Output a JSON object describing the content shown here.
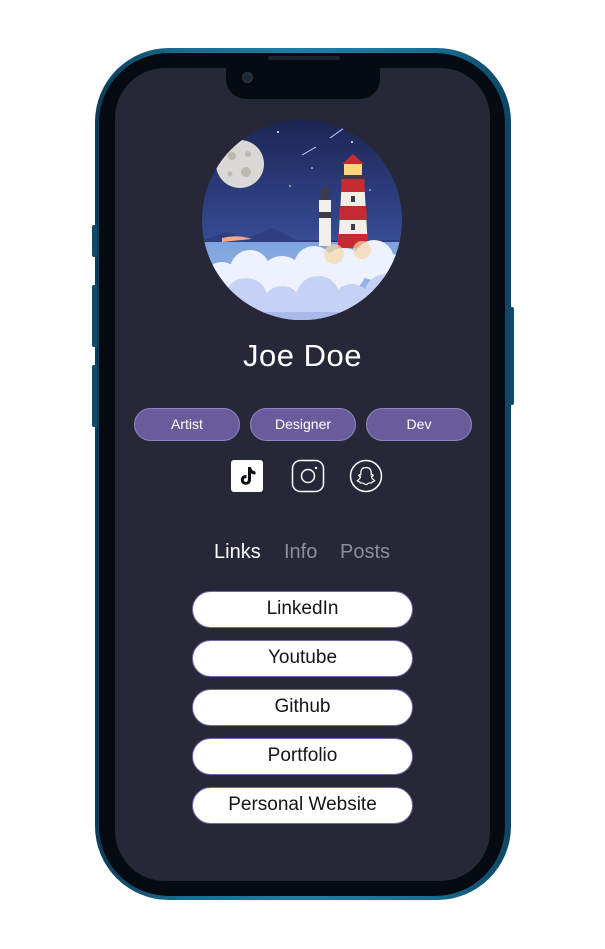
{
  "profile": {
    "name": "Joe Doe",
    "tags": [
      "Artist",
      "Designer",
      "Dev"
    ]
  },
  "social": {
    "icons": [
      "tiktok-icon",
      "instagram-icon",
      "snapchat-icon"
    ]
  },
  "tabs": [
    {
      "label": "Links",
      "active": true
    },
    {
      "label": "Info",
      "active": false
    },
    {
      "label": "Posts",
      "active": false
    }
  ],
  "links": [
    "LinkedIn",
    "Youtube",
    "Github",
    "Portfolio",
    "Personal Website"
  ],
  "colors": {
    "screen_bg": "#262838",
    "tag_bg": "#6a5b9d",
    "link_border": "#7467ad",
    "phone_frame": "#1e7ea6"
  }
}
